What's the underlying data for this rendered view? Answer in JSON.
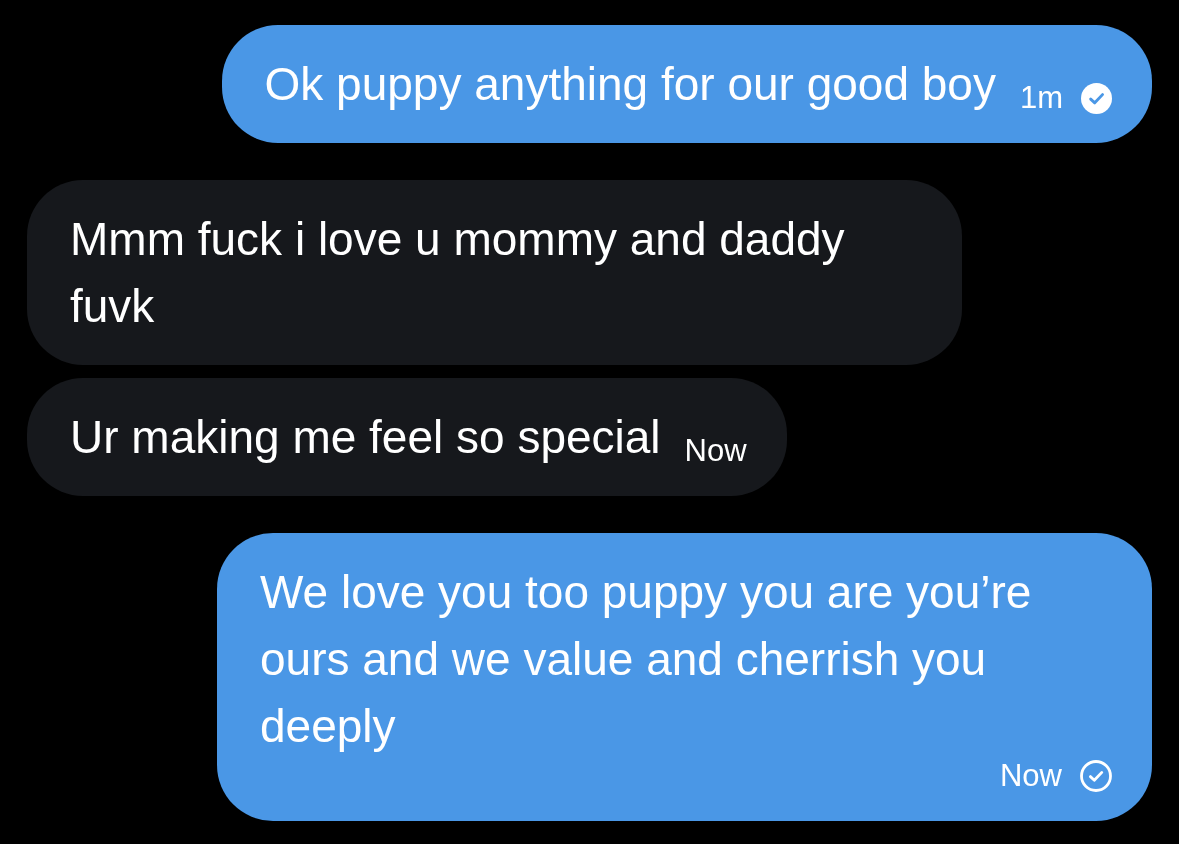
{
  "messages": [
    {
      "kind": "sent",
      "text": "Ok puppy anything for our good boy",
      "time": "1m",
      "read": true
    },
    {
      "kind": "received",
      "text": "Mmm fuck i love u mommy and daddy fuvk"
    },
    {
      "kind": "received",
      "text": "Ur making me feel so special",
      "time": "Now"
    },
    {
      "kind": "sent",
      "text": "We love you too puppy you are you’re ours and we value and cherrish you deeply",
      "time": "Now",
      "read": false
    }
  ]
}
